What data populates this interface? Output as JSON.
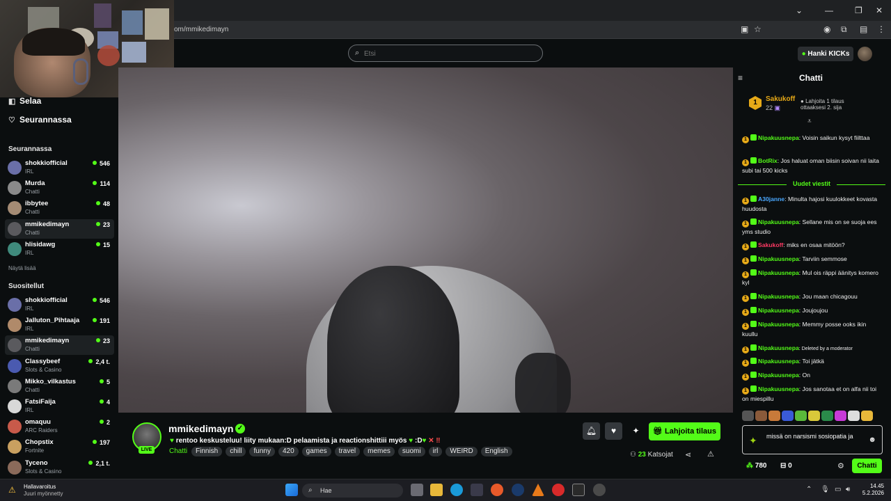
{
  "browser": {
    "url": "om/mmikedimayn",
    "controls": {
      "dropdown": "⌄",
      "minimize": "—",
      "restore": "❐",
      "close": "✕"
    }
  },
  "topbar": {
    "search_placeholder": "Etsi",
    "get_kicks_label": "Hanki KICKs"
  },
  "sidebar": {
    "nav": [
      {
        "label": "Selaa",
        "icon": "browse-icon"
      },
      {
        "label": "Seurannassa",
        "icon": "heart-icon"
      }
    ],
    "following_heading": "Seurannassa",
    "following": [
      {
        "name": "shokkiofficial",
        "category": "IRL",
        "viewers": "546",
        "color": "#6a6fa8"
      },
      {
        "name": "Murda",
        "category": "Chatti",
        "viewers": "114",
        "color": "#8a8a8a"
      },
      {
        "name": "ibbytee",
        "category": "Chatti",
        "viewers": "48",
        "color": "#a48b74"
      },
      {
        "name": "mmikedimayn",
        "category": "Chatti",
        "viewers": "23",
        "color": "#5a5a5e"
      },
      {
        "name": "hlisidawg",
        "category": "IRL",
        "viewers": "15",
        "color": "#3f8a7c"
      }
    ],
    "show_all": "Näytä lisää",
    "recommended_heading": "Suositellut",
    "recommended": [
      {
        "name": "shokkiofficial",
        "category": "IRL",
        "viewers": "546",
        "color": "#6a6fa8"
      },
      {
        "name": "Jalluton_Pihtaaja",
        "category": "IRL",
        "viewers": "191",
        "color": "#b08a6a"
      },
      {
        "name": "mmikedimayn",
        "category": "Chatti",
        "viewers": "23",
        "color": "#5a5a5e"
      },
      {
        "name": "Classybeef",
        "category": "Slots & Casino",
        "viewers": "2,4 t.",
        "color": "#4a5ab0"
      },
      {
        "name": "Mikko_vilkastus",
        "category": "Chatti",
        "viewers": "5",
        "color": "#7a7a7a"
      },
      {
        "name": "FatsiFaija",
        "category": "IRL",
        "viewers": "4",
        "color": "#d8d8d8"
      },
      {
        "name": "omaquu",
        "category": "ARC Raiders",
        "viewers": "2",
        "color": "#c85a4a"
      },
      {
        "name": "Chopstix",
        "category": "Fortnite",
        "viewers": "197",
        "color": "#c9a060"
      },
      {
        "name": "Tyceno",
        "category": "Slots & Casino",
        "viewers": "2,1 t.",
        "color": "#8a6a5a"
      }
    ]
  },
  "stream": {
    "channel": "mmikedimayn",
    "live_label": "LIVE",
    "title_text": "rentoo keskusteluu! liity mukaan:D pelaamista ja reactionshittiii myös",
    "title_suffix": ":D",
    "category": "Chatti",
    "tags": [
      "Finnish",
      "chill",
      "funny",
      "420",
      "games",
      "travel",
      "memes",
      "suomi",
      "irl",
      "WEIRD",
      "English"
    ],
    "subscribe_label": "Lahjoita tilaus",
    "viewers_count": "23",
    "viewers_label": "Katsojat"
  },
  "chat": {
    "title": "Chatti",
    "pinned": {
      "rank": "1",
      "name": "Sakukoff",
      "count": "22",
      "gift_note": "Lahjoita 1 tilaus ottaaksesi 2. sija"
    },
    "messages_before": [
      {
        "user": "Nipakuusnepa",
        "text": ": Voisin saikun kysyt fiilttaa",
        "style": ""
      },
      {
        "user": "BotRix",
        "text": ": Jos haluat oman biisin soivan nii laita subi tai 500 kicks",
        "style": ""
      }
    ],
    "new_messages_label": "Uudet viestit",
    "messages_after": [
      {
        "user": "A30janne",
        "text": ": Minulta hajosi kuulokkeet kovasta huudosta",
        "style": "blue"
      },
      {
        "user": "Nipakuusnepa",
        "text": ": Sellane mis on se suoja ees yms studio",
        "style": ""
      },
      {
        "user": "Sakukoff",
        "text": ": miks en osaa mitöön?",
        "style": "red"
      },
      {
        "user": "Nipakuusnepa",
        "text": ": Tarviin semmose",
        "style": ""
      },
      {
        "user": "Nipakuusnepa",
        "text": ": Mul ois räppi äänitys komero kyl",
        "style": ""
      },
      {
        "user": "Nipakuusnepa",
        "text": ": Jou maan chicagouu",
        "style": ""
      },
      {
        "user": "Nipakuusnepa",
        "text": ": Joujoujou",
        "style": ""
      },
      {
        "user": "Nipakuusnepa",
        "text": ": Memmy posse ooks ikin kuullu",
        "style": ""
      },
      {
        "user": "Nipakuusnepa",
        "text": ": Deleted by a moderator",
        "style": "deleted"
      },
      {
        "user": "Nipakuusnepa",
        "text": ": Toi jätkä",
        "style": ""
      },
      {
        "user": "Nipakuusnepa",
        "text": ": On",
        "style": ""
      },
      {
        "user": "Nipakuusnepa",
        "text": ": Jos sanotaa et on alfa nii toi on miespillu",
        "style": ""
      }
    ],
    "input_text": "missä on narsismi sosiopatia ja",
    "points": "780",
    "gifts": "0",
    "send_label": "Chatti"
  },
  "taskbar": {
    "notification_title": "Hallavaroitus",
    "notification_sub": "Juuri myönnetty",
    "search_label": "Hae",
    "time": "14.45",
    "date": "5.2.2026"
  }
}
